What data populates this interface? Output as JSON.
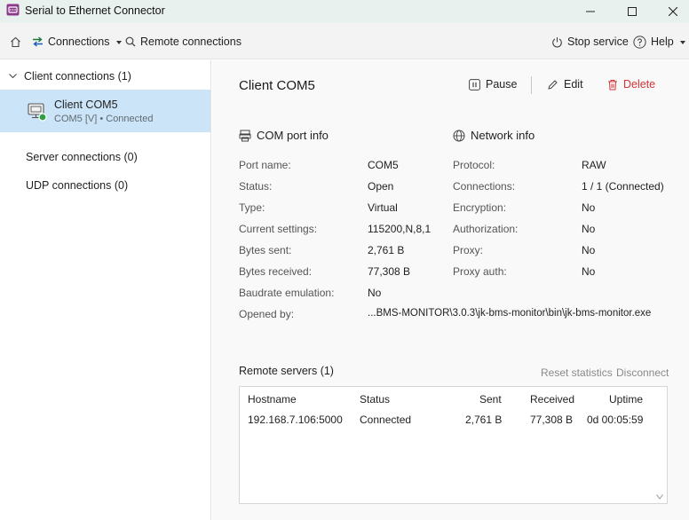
{
  "window": {
    "title": "Serial to Ethernet Connector"
  },
  "toolbar": {
    "connections_label": "Connections",
    "remote_label": "Remote connections",
    "stop_label": "Stop service",
    "help_label": "Help"
  },
  "sidebar": {
    "client_group": "Client connections (1)",
    "selected_item": {
      "title": "Client COM5",
      "subtitle": "COM5 [V] • Connected",
      "status_color": "#2ea043"
    },
    "server_group": "Server connections (0)",
    "udp_group": "UDP connections (0)"
  },
  "main": {
    "title": "Client COM5",
    "actions": {
      "pause": "Pause",
      "edit": "Edit",
      "delete": "Delete"
    },
    "com_port_info": {
      "title": "COM port info",
      "rows": [
        {
          "label": "Port name:",
          "value": "COM5"
        },
        {
          "label": "Status:",
          "value": "Open"
        },
        {
          "label": "Type:",
          "value": "Virtual"
        },
        {
          "label": "Current settings:",
          "value": "115200,N,8,1"
        },
        {
          "label": "Bytes sent:",
          "value": "2,761 B"
        },
        {
          "label": "Bytes received:",
          "value": "77,308 B"
        },
        {
          "label": "Baudrate emulation:",
          "value": "No"
        },
        {
          "label": "Opened by:",
          "value": "...BMS-MONITOR\\3.0.3\\jk-bms-monitor\\bin\\jk-bms-monitor.exe"
        }
      ]
    },
    "network_info": {
      "title": "Network info",
      "rows": [
        {
          "label": "Protocol:",
          "value": "RAW"
        },
        {
          "label": "Connections:",
          "value": "1 / 1 (Connected)"
        },
        {
          "label": "Encryption:",
          "value": "No"
        },
        {
          "label": "Authorization:",
          "value": "No"
        },
        {
          "label": "Proxy:",
          "value": "No"
        },
        {
          "label": "Proxy auth:",
          "value": "No"
        }
      ]
    },
    "remote_servers": {
      "title": "Remote servers (1)",
      "reset_label": "Reset statistics",
      "disconnect_label": "Disconnect",
      "columns": [
        "Hostname",
        "Status",
        "Sent",
        "Received",
        "Uptime"
      ],
      "rows": [
        [
          "192.168.7.106:5000",
          "Connected",
          "2,761 B",
          "77,308 B",
          "0d 00:05:59"
        ]
      ]
    }
  },
  "colors": {
    "accent_delete": "#d13438",
    "selection": "#cce4f7",
    "connections_icon": "#1e7a3c"
  }
}
